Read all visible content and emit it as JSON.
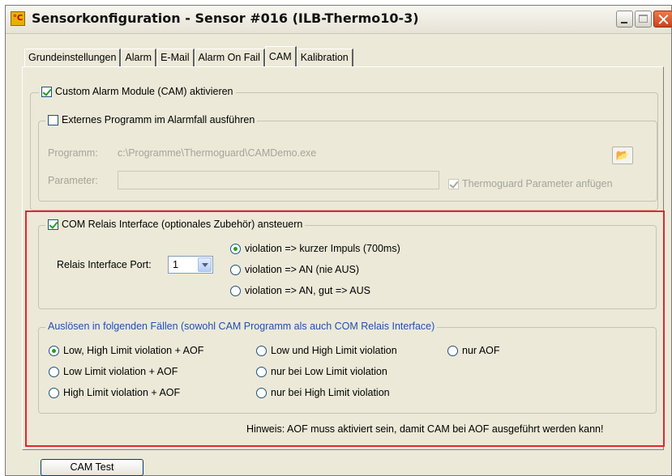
{
  "window": {
    "title": "Sensorkonfiguration - Sensor #016 (ILB-Thermo10-3)",
    "app_icon_text": "°C"
  },
  "tabs": [
    {
      "label": "Grundeinstellungen",
      "active": false
    },
    {
      "label": "Alarm",
      "active": false
    },
    {
      "label": "E-Mail",
      "active": false
    },
    {
      "label": "Alarm On Fail",
      "active": false
    },
    {
      "label": "CAM",
      "active": true
    },
    {
      "label": "Kalibration",
      "active": false
    }
  ],
  "cam": {
    "enable_label": "Custom Alarm Module (CAM) aktivieren",
    "enable_checked": true,
    "external": {
      "label": "Externes Programm im Alarmfall ausführen",
      "checked": false,
      "program_label": "Programm:",
      "program_value": "c:\\Programme\\Thermoguard\\CAMDemo.exe",
      "parameter_label": "Parameter:",
      "parameter_value": "",
      "append_params_label": "Thermoguard Parameter anfügen",
      "append_params_checked": true
    }
  },
  "com": {
    "label": "COM Relais Interface (optionales Zubehör) ansteuern",
    "checked": true,
    "port_label": "Relais Interface Port:",
    "port_value": "1",
    "modes": [
      {
        "label": "violation => kurzer Impuls (700ms)",
        "checked": true
      },
      {
        "label": "violation => AN  (nie AUS)",
        "checked": false
      },
      {
        "label": "violation => AN, gut => AUS",
        "checked": false
      }
    ]
  },
  "trigger": {
    "title": "Auslösen in folgenden Fällen (sowohl CAM Programm als auch COM Relais Interface)",
    "options": [
      {
        "label": "Low, High Limit violation + AOF",
        "checked": true
      },
      {
        "label": "Low Limit violation + AOF",
        "checked": false
      },
      {
        "label": "High Limit violation + AOF",
        "checked": false
      },
      {
        "label": "Low und High Limit violation",
        "checked": false
      },
      {
        "label": "nur bei Low Limit violation",
        "checked": false
      },
      {
        "label": "nur bei High Limit violation",
        "checked": false
      },
      {
        "label": "nur AOF",
        "checked": false
      }
    ]
  },
  "hint": "Hinweis: AOF muss aktiviert sein, damit CAM bei AOF ausgeführt werden kann!",
  "cam_test_label": "CAM Test",
  "colors": {
    "window_bg": "#ece9d8",
    "highlight_border": "#e3262c",
    "group_title_blue": "#1f4fb4",
    "check_green": "#21a121"
  },
  "icons": [
    "thermometer-app-icon",
    "minimize-icon",
    "maximize-icon",
    "close-icon",
    "folder-open-icon",
    "chevron-down-icon"
  ]
}
